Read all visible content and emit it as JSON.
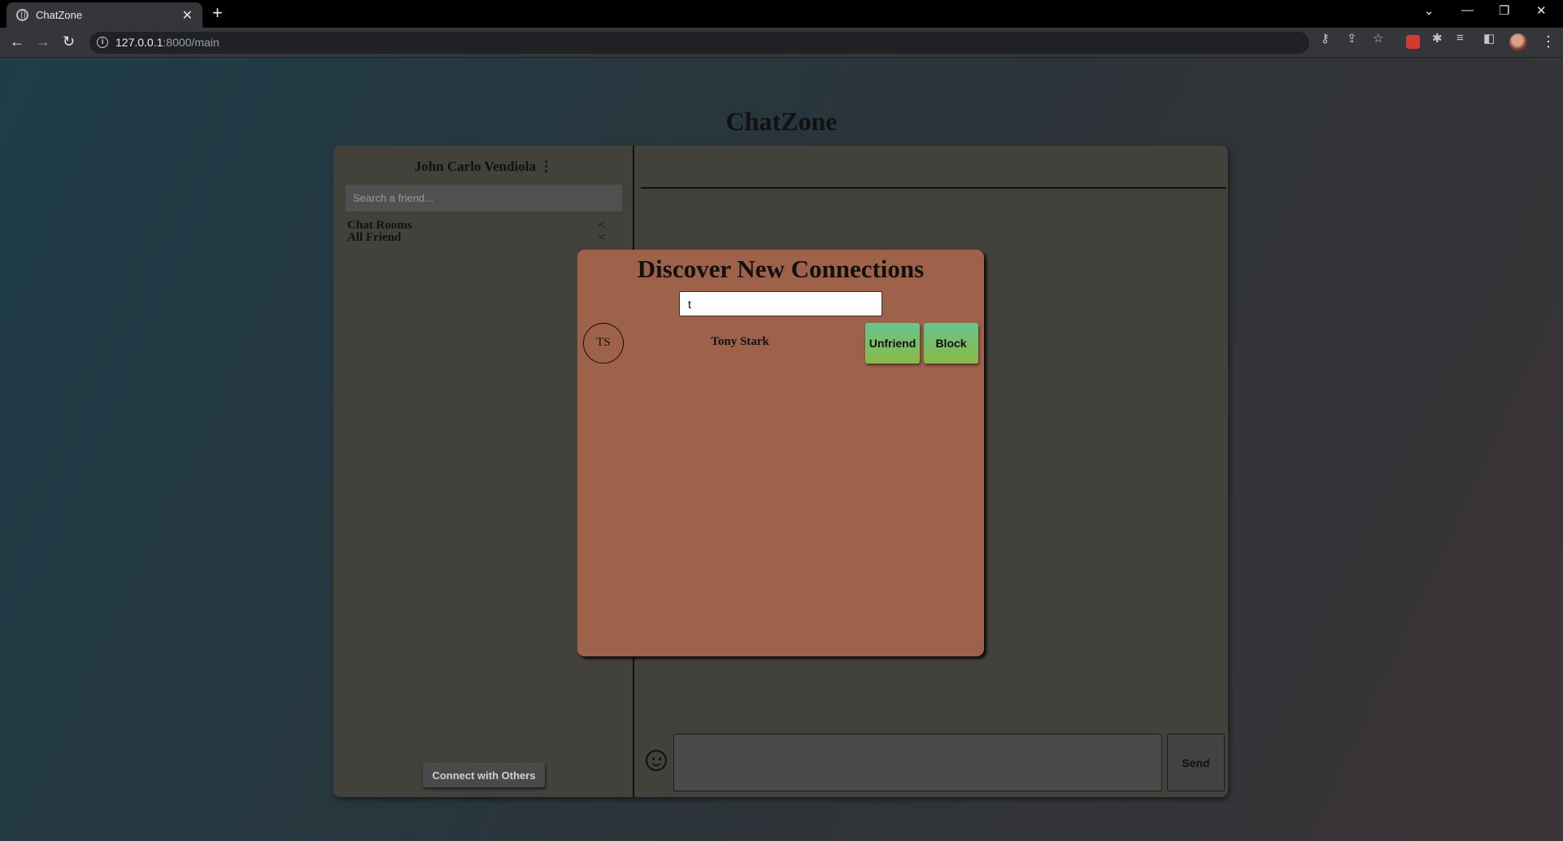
{
  "browser": {
    "tab_title": "ChatZone",
    "url_host": "127.0.0.1",
    "url_path": ":8000/main"
  },
  "app": {
    "title": "ChatZone"
  },
  "sidebar": {
    "user_name": "John Carlo Vendiola ⋮",
    "search_placeholder": "Search a friend...",
    "items": [
      {
        "label": "Chat Rooms",
        "chevron": "<"
      },
      {
        "label": "All Friend",
        "chevron": "<"
      }
    ],
    "connect_button": "Connect with Others"
  },
  "chat": {
    "message_value": "",
    "send_label": "Send",
    "emoji_icon": "smiley-icon"
  },
  "modal": {
    "title": "Discover New Connections",
    "search_value": "t",
    "results": [
      {
        "initials": "TS",
        "name": "Tony Stark",
        "actions": [
          "Unfriend",
          "Block"
        ]
      }
    ]
  },
  "colors": {
    "modal_bg": "#9e614a",
    "card_bg": "#42413b",
    "button_gradient_top": "#68c48e",
    "button_gradient_bottom": "#8ab846"
  }
}
